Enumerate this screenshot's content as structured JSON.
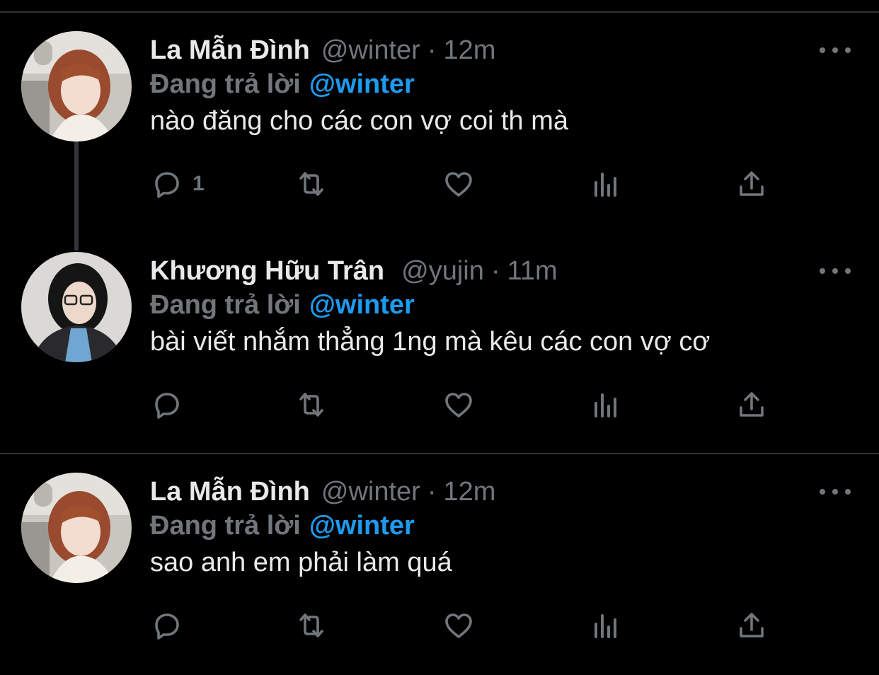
{
  "colors": {
    "background": "#000000",
    "text": "#e7e9ea",
    "muted": "#71767b",
    "accent": "#1d9bf0",
    "divider": "#2f3336"
  },
  "tweets": [
    {
      "name": "La Mẫn Đình",
      "handle": "@winter",
      "dot": "·",
      "time": "12m",
      "reply_prefix": "Đang trả lời",
      "reply_handle": "@winter",
      "text": "nào đăng cho các con vợ coi th mà",
      "reply_count": "1",
      "icons": [
        "reply-icon",
        "retweet-icon",
        "like-icon",
        "analytics-icon",
        "share-icon"
      ]
    },
    {
      "name": "Khương Hữu Trân",
      "handle": "@yujin",
      "dot": "·",
      "time": "11m",
      "reply_prefix": "Đang trả lời",
      "reply_handle": "@winter",
      "text": "bài viết nhắm thẳng 1ng mà kêu các con vợ cơ",
      "reply_count": "",
      "icons": [
        "reply-icon",
        "retweet-icon",
        "like-icon",
        "analytics-icon",
        "share-icon"
      ]
    },
    {
      "name": "La Mẫn Đình",
      "handle": "@winter",
      "dot": "·",
      "time": "12m",
      "reply_prefix": "Đang trả lời",
      "reply_handle": "@winter",
      "text": "sao anh em phải làm quá",
      "reply_count": "",
      "icons": [
        "reply-icon",
        "retweet-icon",
        "like-icon",
        "analytics-icon",
        "share-icon"
      ]
    }
  ]
}
